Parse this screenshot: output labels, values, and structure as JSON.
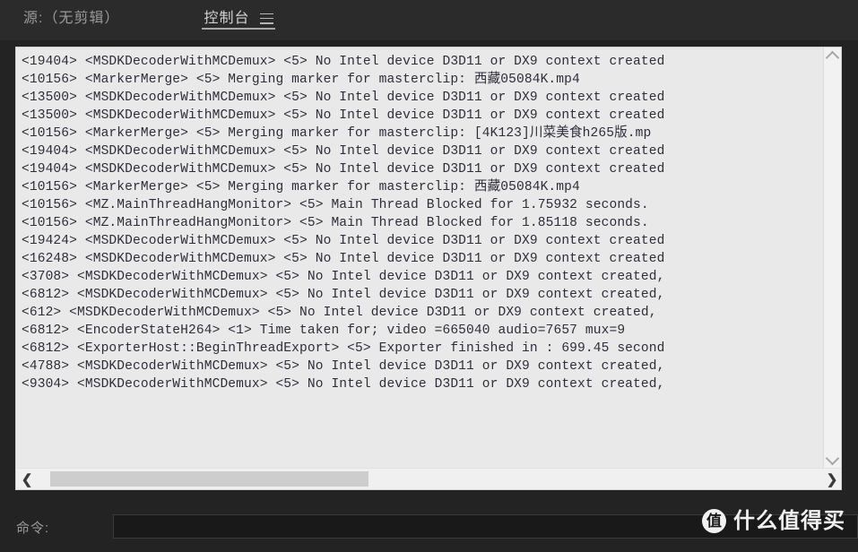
{
  "window": {
    "background_color": "#232323",
    "panel_background_color": "#e9e9e9",
    "text_color": "#2e2e3a"
  },
  "tabbar": {
    "source_tab_label": "源:（无剪辑）",
    "console_tab_label": "控制台",
    "menu_icon": "hamburger-icon"
  },
  "console": {
    "lines": [
      "<19404> <MSDKDecoderWithMCDemux> <5> No Intel device D3D11 or DX9 context created",
      "<10156> <MarkerMerge> <5> Merging marker for masterclip: 西藏05084K.mp4",
      "<13500> <MSDKDecoderWithMCDemux> <5> No Intel device D3D11 or DX9 context created",
      "<13500> <MSDKDecoderWithMCDemux> <5> No Intel device D3D11 or DX9 context created",
      "<10156> <MarkerMerge> <5> Merging marker for masterclip: [4K123]川菜美食h265版.mp",
      "<19404> <MSDKDecoderWithMCDemux> <5> No Intel device D3D11 or DX9 context created",
      "<19404> <MSDKDecoderWithMCDemux> <5> No Intel device D3D11 or DX9 context created",
      "<10156> <MarkerMerge> <5> Merging marker for masterclip: 西藏05084K.mp4",
      "<10156> <MZ.MainThreadHangMonitor> <5> Main Thread Blocked for 1.75932 seconds.",
      "<10156> <MZ.MainThreadHangMonitor> <5> Main Thread Blocked for 1.85118 seconds.",
      "<19424> <MSDKDecoderWithMCDemux> <5> No Intel device D3D11 or DX9 context created",
      "<16248> <MSDKDecoderWithMCDemux> <5> No Intel device D3D11 or DX9 context created",
      "<3708> <MSDKDecoderWithMCDemux> <5> No Intel device D3D11 or DX9 context created,",
      "<6812> <MSDKDecoderWithMCDemux> <5> No Intel device D3D11 or DX9 context created,",
      "<612> <MSDKDecoderWithMCDemux> <5> No Intel device D3D11 or DX9 context created,",
      "<6812> <EncoderStateH264> <1> Time taken for; video =665040 audio=7657 mux=9",
      "<6812> <ExporterHost::BeginThreadExport> <5> Exporter finished in : 699.45 second",
      "<4788> <MSDKDecoderWithMCDemux> <5> No Intel device D3D11 or DX9 context created,",
      "<9304> <MSDKDecoderWithMCDemux> <5> No Intel device D3D11 or DX9 context created,"
    ],
    "vertical_scroll_up_icon": "chevron-up-icon",
    "vertical_scroll_down_icon": "chevron-down-icon",
    "horizontal_scroll_left_icon": "chevron-left-icon",
    "horizontal_scroll_right_icon": "chevron-right-icon",
    "horizontal_scroll_left_glyph": "❮",
    "horizontal_scroll_right_glyph": "❯"
  },
  "command": {
    "label": "命令:",
    "value": "",
    "placeholder": ""
  },
  "watermark": {
    "badge_text": "值",
    "text": "什么值得买"
  }
}
